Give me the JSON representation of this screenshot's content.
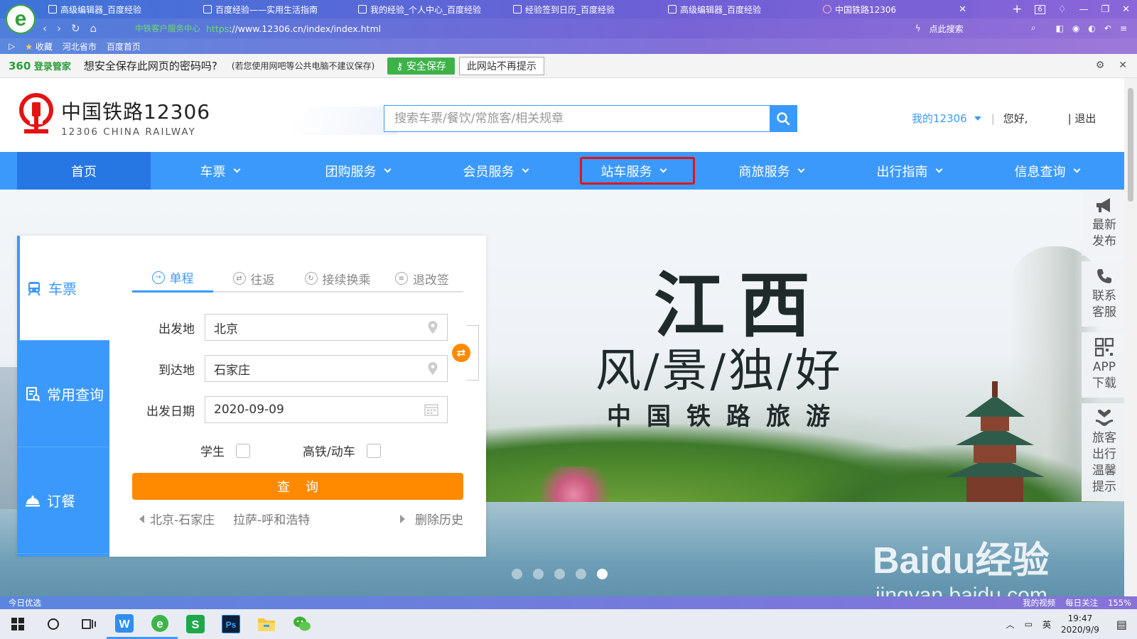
{
  "browser": {
    "logo_letter": "e",
    "tabs": [
      {
        "label": "高级编辑器_百度经验"
      },
      {
        "label": "百度经验——实用生活指南"
      },
      {
        "label": "我的经验_个人中心_百度经验"
      },
      {
        "label": "经验签到日历_百度经验"
      },
      {
        "label": "高级编辑器_百度经验"
      },
      {
        "label": "中国铁路12306",
        "active": true
      }
    ],
    "tab_count": "6",
    "secure_label": "中铁客户服务中心",
    "url_proto": "https",
    "url_rest": "://www.12306.cn/index/index.html",
    "search_hint": "点此搜索",
    "bookmarks": [
      "收藏",
      "河北省市",
      "百度首页"
    ]
  },
  "password_bar": {
    "brand_num": "360",
    "brand_text": "登录管家",
    "question": "想安全保存此网页的密码吗?",
    "note": "(若您使用网吧等公共电脑不建议保存)",
    "save_label": "安全保存",
    "never_label": "此网站不再提示"
  },
  "site": {
    "logo_cn": "中国铁路12306",
    "logo_en": "12306 CHINA RAILWAY",
    "search_placeholder": "搜索车票/餐饮/常旅客/相关规章",
    "my12306": "我的12306",
    "separator": "|",
    "hello": "您好,",
    "logout": "| 退出",
    "nav": [
      {
        "label": "首页",
        "chevron": false
      },
      {
        "label": "车票",
        "chevron": true
      },
      {
        "label": "团购服务",
        "chevron": true
      },
      {
        "label": "会员服务",
        "chevron": true
      },
      {
        "label": "站车服务",
        "chevron": true,
        "highlighted": true
      },
      {
        "label": "商旅服务",
        "chevron": true
      },
      {
        "label": "出行指南",
        "chevron": true
      },
      {
        "label": "信息查询",
        "chevron": true
      }
    ],
    "accent_color": "#3b99fc",
    "highlight_color": "#e31414"
  },
  "banner": {
    "title": "江西",
    "subtitle": "风/景/独/好",
    "tagline": "中国铁路旅游",
    "dots": 5,
    "active_dot": 5
  },
  "booking": {
    "side_tabs": [
      "车票",
      "常用查询",
      "订餐"
    ],
    "trip_tabs": [
      "单程",
      "往返",
      "接续换乘",
      "退改签"
    ],
    "from_label": "出发地",
    "from_value": "北京",
    "to_label": "到达地",
    "to_value": "石家庄",
    "date_label": "出发日期",
    "date_value": "2020-09-09",
    "student_label": "学生",
    "highspeed_label": "高铁/动车",
    "search_label": "查询",
    "history": [
      "北京-石家庄",
      "拉萨-呼和浩特"
    ],
    "delete_history": "删除历史",
    "button_color": "#ff8a00"
  },
  "floating": [
    {
      "icon": "megaphone-icon",
      "label": "最新发布"
    },
    {
      "icon": "phone-icon",
      "label": "联系客服"
    },
    {
      "icon": "qrcode-icon",
      "label": "APP下载"
    },
    {
      "icon": "heart-hand-icon",
      "label": "旅客出行温馨提示"
    }
  ],
  "watermark": {
    "text": "Baidu经验",
    "url": "jingyan.baidu.com"
  },
  "statusbar": {
    "left": "今日优选",
    "video": "我的视频",
    "follow": "每日关注",
    "zoom": "155%"
  },
  "taskbar": {
    "time": "19:47",
    "date": "2020/9/9",
    "ime": "英"
  }
}
